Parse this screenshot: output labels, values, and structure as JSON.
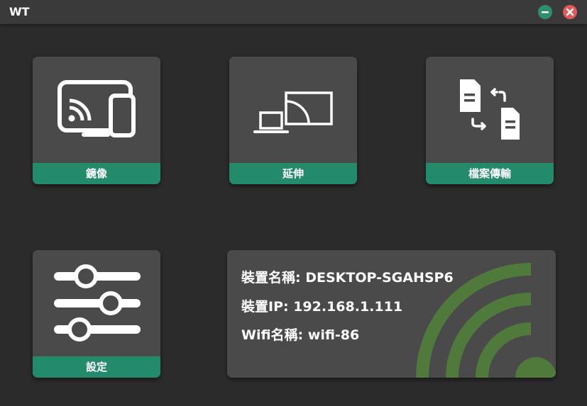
{
  "window": {
    "title": "WT"
  },
  "tiles": {
    "mirror": {
      "label": "鏡像",
      "icon": "cast-screen-icon"
    },
    "extend": {
      "label": "延伸",
      "icon": "extend-display-icon"
    },
    "file_transfer": {
      "label": "檔案傳輸",
      "icon": "file-transfer-icon"
    },
    "settings": {
      "label": "設定",
      "icon": "sliders-icon"
    }
  },
  "device_info": {
    "device_name": "裝置名稱: DESKTOP-SGAHSP6",
    "device_ip": "裝置IP: 192.168.1.111",
    "wifi_name": "Wifi名稱:  wifi-86"
  },
  "colors": {
    "accent": "#248a6c",
    "tile_bg": "#4a4a4a",
    "window_bg": "#2b2b2b",
    "titlebar_bg": "#3a3a3a",
    "minimize": "#2e8f6e",
    "close": "#e05a5a",
    "wifi_graphic": "#4f7a3c"
  }
}
